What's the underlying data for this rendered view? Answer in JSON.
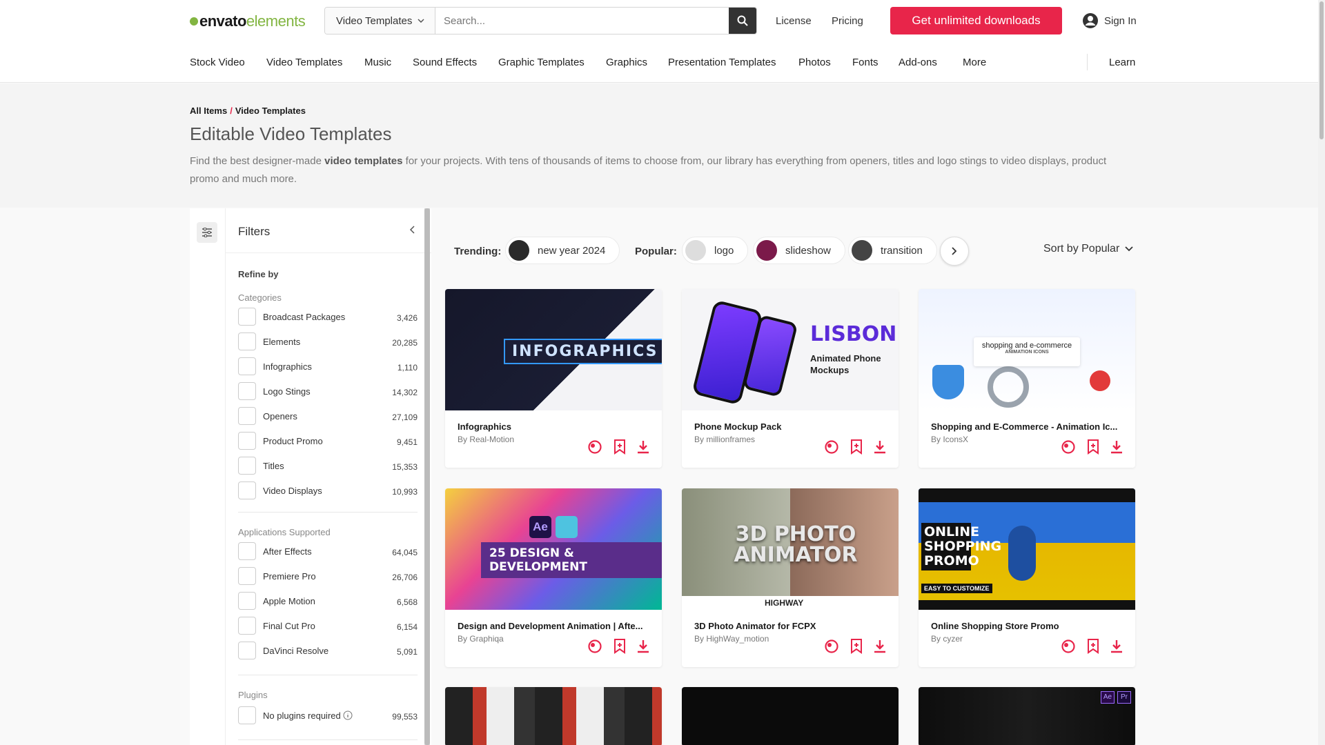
{
  "brand": {
    "part1": "envato",
    "part2": "elements"
  },
  "search": {
    "category": "Video Templates",
    "placeholder": "Search..."
  },
  "top_links": {
    "license": "License",
    "pricing": "Pricing",
    "cta": "Get unlimited downloads",
    "signin": "Sign In"
  },
  "nav": [
    "Stock Video",
    "Video Templates",
    "Music",
    "Sound Effects",
    "Graphic Templates",
    "Graphics",
    "Presentation Templates",
    "Photos",
    "Fonts",
    "Add-ons",
    "More",
    "Learn"
  ],
  "breadcrumb": {
    "root": "All Items",
    "sep": "/",
    "current": "Video Templates"
  },
  "page_title": "Editable Video Templates",
  "description": {
    "pre": "Find the best designer-made ",
    "bold": "video templates",
    "post": " for your projects. With tens of thousands of items to choose from, our library has everything from openers, titles and logo stings to video displays, product promo and much more."
  },
  "filters": {
    "title": "Filters",
    "refine": "Refine by",
    "categories_label": "Categories",
    "categories": [
      {
        "label": "Broadcast Packages",
        "count": "3,426"
      },
      {
        "label": "Elements",
        "count": "20,285"
      },
      {
        "label": "Infographics",
        "count": "1,110"
      },
      {
        "label": "Logo Stings",
        "count": "14,302"
      },
      {
        "label": "Openers",
        "count": "27,109"
      },
      {
        "label": "Product Promo",
        "count": "9,451"
      },
      {
        "label": "Titles",
        "count": "15,353"
      },
      {
        "label": "Video Displays",
        "count": "10,993"
      }
    ],
    "apps_label": "Applications Supported",
    "apps": [
      {
        "label": "After Effects",
        "count": "64,045"
      },
      {
        "label": "Premiere Pro",
        "count": "26,706"
      },
      {
        "label": "Apple Motion",
        "count": "6,568"
      },
      {
        "label": "Final Cut Pro",
        "count": "6,154"
      },
      {
        "label": "DaVinci Resolve",
        "count": "5,091"
      }
    ],
    "plugins_label": "Plugins",
    "plugins": [
      {
        "label": "No plugins required",
        "count": "99,553"
      }
    ]
  },
  "trending": {
    "trending_label": "Trending:",
    "popular_label": "Popular:",
    "chips": [
      "new year 2024",
      "logo",
      "slideshow",
      "transition"
    ]
  },
  "sort": "Sort by Popular",
  "cards": [
    {
      "title": "Infographics",
      "author": "By Real-Motion",
      "thumb_text": "INFOGRAPHICS"
    },
    {
      "title": "Phone Mockup Pack",
      "author": "By millionframes",
      "thumb_text": "LISBON",
      "thumb_sub": "Animated Phone Mockups"
    },
    {
      "title": "Shopping and E-Commerce - Animation Ic...",
      "author": "By IconsX",
      "thumb_text": "shopping and e-commerce",
      "thumb_sub": "ANIMATION ICONS"
    },
    {
      "title": "Design and Development Animation | Afte...",
      "author": "By Graphiqa",
      "thumb_text": "25 DESIGN & DEVELOPMENT"
    },
    {
      "title": "3D Photo Animator for FCPX",
      "author": "By HighWay_motion",
      "thumb_text": "3D PHOTO ANIMATOR",
      "thumb_sub": "HIGHWAY"
    },
    {
      "title": "Online Shopping Store Promo",
      "author": "By cyzer",
      "thumb_text": "ONLINE SHOPPING PROMO",
      "thumb_sub": "EASY TO CUSTOMIZE"
    }
  ],
  "colors": {
    "accent": "#e8254a",
    "brand_green": "#82b541",
    "dark": "#191919"
  }
}
